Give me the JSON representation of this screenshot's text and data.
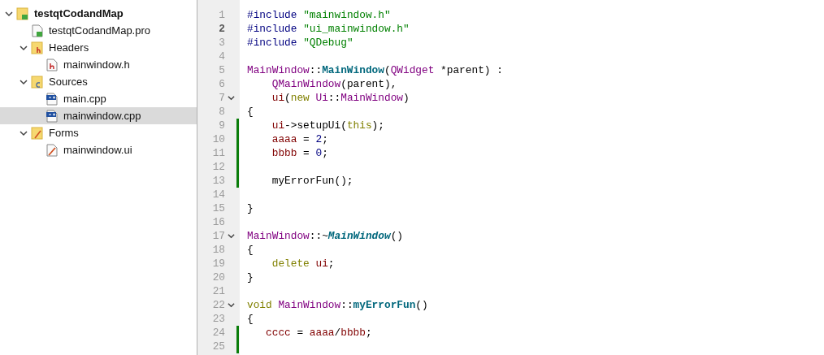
{
  "project_tree": [
    {
      "label": "testqtCodandMap",
      "kind": "project",
      "expanded": true,
      "selected": false,
      "children": [
        {
          "label": "testqtCodandMap.pro",
          "kind": "pro",
          "selected": false
        },
        {
          "label": "Headers",
          "kind": "header-folder",
          "expanded": true,
          "selected": false,
          "children": [
            {
              "label": "mainwindow.h",
              "kind": "header",
              "selected": false
            }
          ]
        },
        {
          "label": "Sources",
          "kind": "source-folder",
          "expanded": true,
          "selected": false,
          "children": [
            {
              "label": "main.cpp",
              "kind": "cpp",
              "selected": false
            },
            {
              "label": "mainwindow.cpp",
              "kind": "cpp",
              "selected": true
            }
          ]
        },
        {
          "label": "Forms",
          "kind": "form-folder",
          "expanded": true,
          "selected": false,
          "children": [
            {
              "label": "mainwindow.ui",
              "kind": "ui",
              "selected": false
            }
          ]
        }
      ]
    }
  ],
  "editor": {
    "lines": [
      {
        "number": "1",
        "current": false,
        "modified": false,
        "fold": false,
        "tokens": [
          {
            "text": "#include ",
            "kind": "preproc"
          },
          {
            "text": "\"mainwindow.h\"",
            "kind": "string"
          }
        ]
      },
      {
        "number": "2",
        "current": true,
        "modified": false,
        "fold": false,
        "tokens": [
          {
            "text": "#include ",
            "kind": "preproc"
          },
          {
            "text": "\"ui_mainwindow.h\"",
            "kind": "string"
          }
        ]
      },
      {
        "number": "3",
        "current": false,
        "modified": false,
        "fold": false,
        "tokens": [
          {
            "text": "#include ",
            "kind": "preproc"
          },
          {
            "text": "\"QDebug\"",
            "kind": "string"
          }
        ]
      },
      {
        "number": "4",
        "current": false,
        "modified": false,
        "fold": false
      },
      {
        "number": "5",
        "current": false,
        "modified": false,
        "fold": false,
        "tokens": [
          {
            "text": "MainWindow",
            "kind": "type"
          },
          {
            "text": "::",
            "kind": "plain"
          },
          {
            "text": "MainWindow",
            "kind": "function"
          },
          {
            "text": "(",
            "kind": "plain"
          },
          {
            "text": "QWidget",
            "kind": "type"
          },
          {
            "text": " *parent) :",
            "kind": "plain"
          }
        ]
      },
      {
        "number": "6",
        "current": false,
        "modified": false,
        "fold": false,
        "tokens": [
          {
            "text": "    QMainWindow",
            "kind": "type"
          },
          {
            "text": "(parent),",
            "kind": "plain"
          }
        ]
      },
      {
        "number": "7",
        "current": false,
        "modified": false,
        "fold": true,
        "tokens": [
          {
            "text": "    ui",
            "kind": "member"
          },
          {
            "text": "(",
            "kind": "plain"
          },
          {
            "text": "new ",
            "kind": "keyword"
          },
          {
            "text": "Ui",
            "kind": "type"
          },
          {
            "text": "::",
            "kind": "plain"
          },
          {
            "text": "MainWindow",
            "kind": "type"
          },
          {
            "text": ")",
            "kind": "plain"
          }
        ]
      },
      {
        "number": "8",
        "current": false,
        "modified": false,
        "fold": false,
        "tokens": [
          {
            "text": "{",
            "kind": "plain"
          }
        ]
      },
      {
        "number": "9",
        "current": false,
        "modified": true,
        "fold": false,
        "tokens": [
          {
            "text": "    ui",
            "kind": "member"
          },
          {
            "text": "->setupUi(",
            "kind": "plain"
          },
          {
            "text": "this",
            "kind": "keyword"
          },
          {
            "text": ");",
            "kind": "plain"
          }
        ]
      },
      {
        "number": "10",
        "current": false,
        "modified": true,
        "fold": false,
        "tokens": [
          {
            "text": "    aaaa",
            "kind": "member"
          },
          {
            "text": " = ",
            "kind": "plain"
          },
          {
            "text": "2",
            "kind": "number"
          },
          {
            "text": ";",
            "kind": "plain"
          }
        ]
      },
      {
        "number": "11",
        "current": false,
        "modified": true,
        "fold": false,
        "tokens": [
          {
            "text": "    bbbb",
            "kind": "member"
          },
          {
            "text": " = ",
            "kind": "plain"
          },
          {
            "text": "0",
            "kind": "number"
          },
          {
            "text": ";",
            "kind": "plain"
          }
        ]
      },
      {
        "number": "12",
        "current": false,
        "modified": true,
        "fold": false
      },
      {
        "number": "13",
        "current": false,
        "modified": true,
        "fold": false,
        "tokens": [
          {
            "text": "    myErrorFun();",
            "kind": "plain"
          }
        ]
      },
      {
        "number": "14",
        "current": false,
        "modified": false,
        "fold": false
      },
      {
        "number": "15",
        "current": false,
        "modified": false,
        "fold": false,
        "tokens": [
          {
            "text": "}",
            "kind": "plain"
          }
        ]
      },
      {
        "number": "16",
        "current": false,
        "modified": false,
        "fold": false
      },
      {
        "number": "17",
        "current": false,
        "modified": false,
        "fold": true,
        "tokens": [
          {
            "text": "MainWindow",
            "kind": "type"
          },
          {
            "text": "::~",
            "kind": "plain"
          },
          {
            "text": "MainWindow",
            "kind": "virtual"
          },
          {
            "text": "()",
            "kind": "plain"
          }
        ]
      },
      {
        "number": "18",
        "current": false,
        "modified": false,
        "fold": false,
        "tokens": [
          {
            "text": "{",
            "kind": "plain"
          }
        ]
      },
      {
        "number": "19",
        "current": false,
        "modified": false,
        "fold": false,
        "tokens": [
          {
            "text": "    delete ",
            "kind": "keyword"
          },
          {
            "text": "ui",
            "kind": "member"
          },
          {
            "text": ";",
            "kind": "plain"
          }
        ]
      },
      {
        "number": "20",
        "current": false,
        "modified": false,
        "fold": false,
        "tokens": [
          {
            "text": "}",
            "kind": "plain"
          }
        ]
      },
      {
        "number": "21",
        "current": false,
        "modified": false,
        "fold": false
      },
      {
        "number": "22",
        "current": false,
        "modified": false,
        "fold": true,
        "tokens": [
          {
            "text": "void ",
            "kind": "keyword"
          },
          {
            "text": "MainWindow",
            "kind": "type"
          },
          {
            "text": "::",
            "kind": "plain"
          },
          {
            "text": "myErrorFun",
            "kind": "function"
          },
          {
            "text": "()",
            "kind": "plain"
          }
        ]
      },
      {
        "number": "23",
        "current": false,
        "modified": false,
        "fold": false,
        "tokens": [
          {
            "text": "{",
            "kind": "plain"
          }
        ]
      },
      {
        "number": "24",
        "current": false,
        "modified": true,
        "fold": false,
        "tokens": [
          {
            "text": "   cccc",
            "kind": "member"
          },
          {
            "text": " = ",
            "kind": "plain"
          },
          {
            "text": "aaaa",
            "kind": "member"
          },
          {
            "text": "/",
            "kind": "plain"
          },
          {
            "text": "bbbb",
            "kind": "member"
          },
          {
            "text": ";",
            "kind": "plain"
          }
        ]
      },
      {
        "number": "25",
        "current": false,
        "modified": true,
        "fold": false
      }
    ]
  }
}
